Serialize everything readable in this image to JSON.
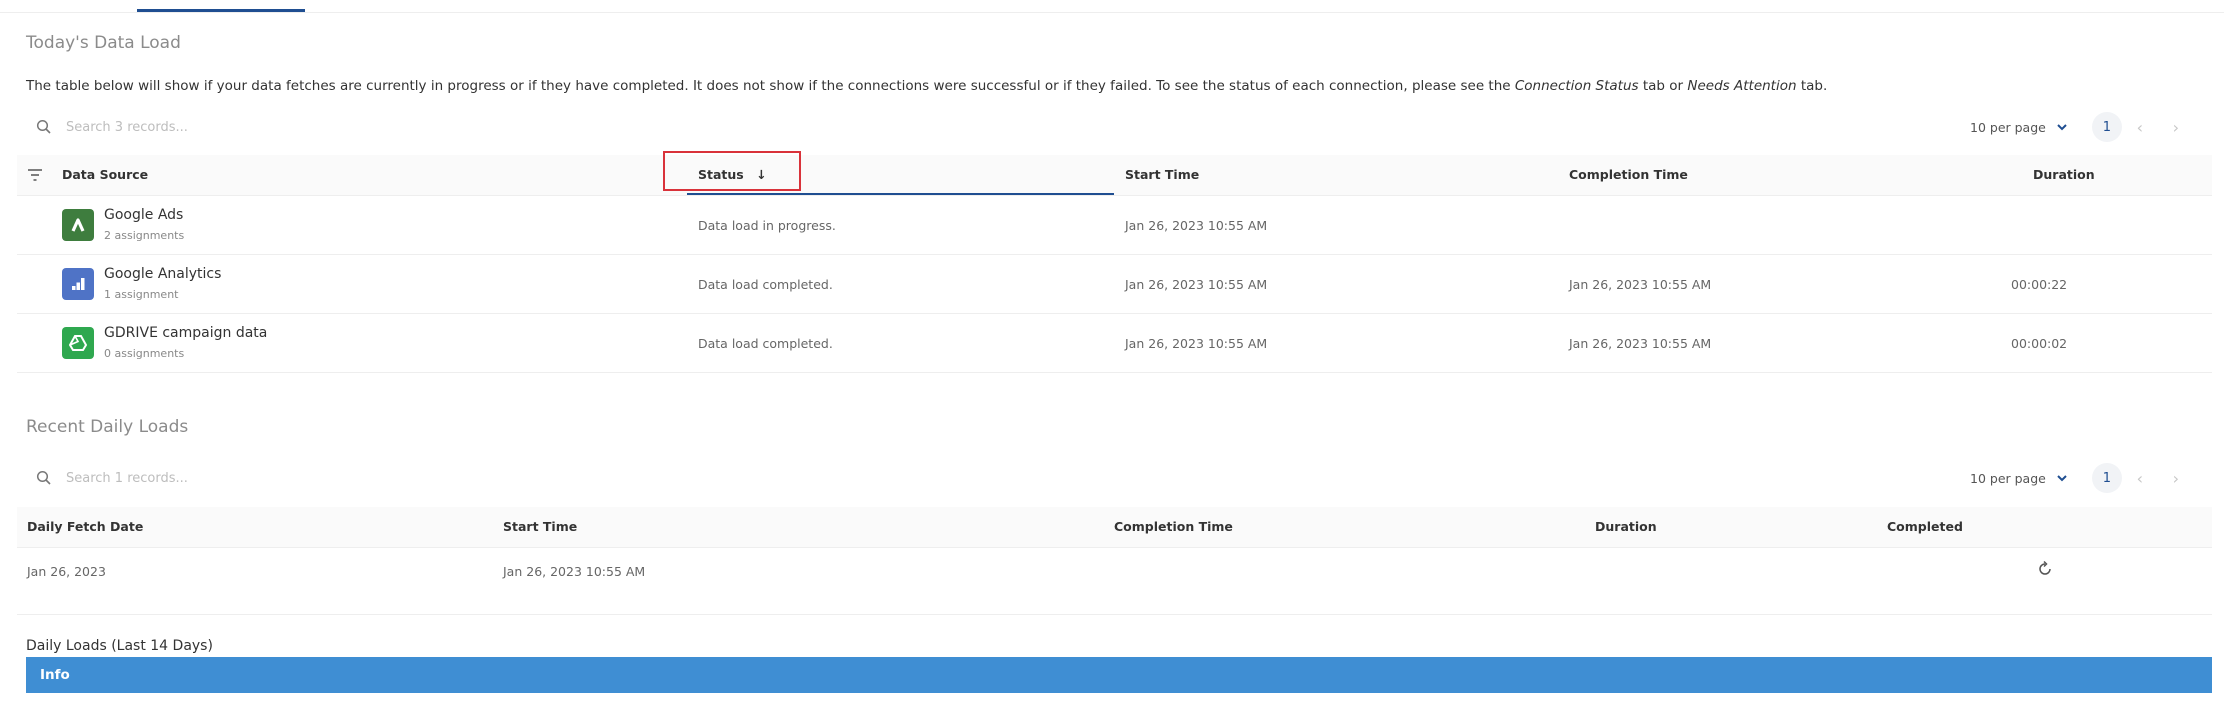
{
  "today": {
    "title": "Today's Data Load",
    "description_parts": [
      "The table below will show if your data fetches are currently in progress or if they have completed. It does not show if the connections were successful or if they failed. To see the status of each connection, please see the ",
      "Connection Status",
      " tab or ",
      "Needs Attention",
      " tab."
    ],
    "search_placeholder": "Search 3 records...",
    "per_page": "10 per page",
    "page": "1",
    "columns": [
      "Data Source",
      "Status",
      "Start Time",
      "Completion Time",
      "Duration"
    ],
    "rows": [
      {
        "name": "Google Ads",
        "sub": "2 assignments",
        "icon": "google-ads-icon",
        "icon_color": "#3e7d3e",
        "status": "Data load in progress.",
        "start": "Jan 26, 2023 10:55 AM",
        "completion": "",
        "duration": ""
      },
      {
        "name": "Google Analytics",
        "sub": "1 assignment",
        "icon": "google-analytics-icon",
        "icon_color": "#4f73c6",
        "status": "Data load completed.",
        "start": "Jan 26, 2023 10:55 AM",
        "completion": "Jan 26, 2023 10:55 AM",
        "duration": "00:00:22"
      },
      {
        "name": "GDRIVE campaign data",
        "sub": "0 assignments",
        "icon": "google-drive-icon",
        "icon_color": "#2fa84f",
        "status": "Data load completed.",
        "start": "Jan 26, 2023 10:55 AM",
        "completion": "Jan 26, 2023 10:55 AM",
        "duration": "00:00:02"
      }
    ]
  },
  "recent": {
    "title": "Recent Daily Loads",
    "search_placeholder": "Search 1 records...",
    "per_page": "10 per page",
    "page": "1",
    "columns": [
      "Daily Fetch Date",
      "Start Time",
      "Completion Time",
      "Duration",
      "Completed"
    ],
    "rows": [
      {
        "date": "Jan 26, 2023",
        "start": "Jan 26, 2023 10:55 AM",
        "completion": "",
        "duration": "",
        "completed_icon": "refresh-icon"
      }
    ]
  },
  "last14": {
    "title": "Daily Loads (Last 14 Days)",
    "info_label": "Info"
  },
  "colors": {
    "accent": "#1f4e91",
    "highlight": "#d9323a",
    "info": "#3f8ed3"
  }
}
